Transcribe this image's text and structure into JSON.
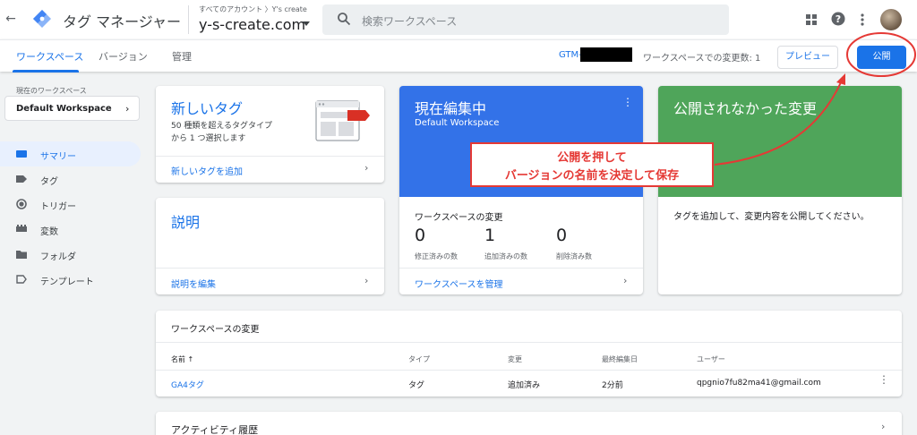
{
  "header": {
    "app_name": "タグ マネージャー",
    "account_crumb": "すべてのアカウント 〉Y's create",
    "container_name": "y-s-create.com",
    "search_placeholder": "検索ワークスペース"
  },
  "subnav": {
    "tabs": [
      {
        "label": "ワークスペース"
      },
      {
        "label": "バージョン"
      },
      {
        "label": "管理"
      }
    ],
    "gtm_id": "GTM-",
    "changes_count": "ワークスペースでの変更数: 1",
    "preview_label": "プレビュー",
    "publish_label": "公開"
  },
  "sidebar": {
    "current_ws_label": "現在のワークスペース",
    "workspace_name": "Default Workspace",
    "items": [
      {
        "label": "サマリー",
        "icon": "summary-icon"
      },
      {
        "label": "タグ",
        "icon": "tag-icon"
      },
      {
        "label": "トリガー",
        "icon": "trigger-icon"
      },
      {
        "label": "変数",
        "icon": "variable-icon"
      },
      {
        "label": "フォルダ",
        "icon": "folder-icon"
      },
      {
        "label": "テンプレート",
        "icon": "template-icon"
      }
    ]
  },
  "cards": {
    "new_tag": {
      "title": "新しいタグ",
      "desc_line1": "50 種類を超えるタグタイプ",
      "desc_line2": "から 1 つ選択します",
      "link": "新しいタグを追加"
    },
    "description": {
      "title": "説明",
      "link": "説明を編集"
    },
    "current": {
      "title": "現在編集中",
      "workspace": "Default Workspace",
      "changes_title": "ワークスペースの変更",
      "stats": [
        {
          "value": "0",
          "label": "修正済みの数"
        },
        {
          "value": "1",
          "label": "追加済みの数"
        },
        {
          "value": "0",
          "label": "削除済み数"
        }
      ],
      "link": "ワークスペースを管理"
    },
    "unpublished": {
      "title": "公開されなかった変更",
      "text": "タグを追加して、変更内容を公開してください。"
    }
  },
  "changes_table": {
    "title": "ワークスペースの変更",
    "columns": [
      "名前 ↑",
      "タイプ",
      "変更",
      "最終編集日",
      "ユーザー"
    ],
    "rows": [
      {
        "name": "GA4タグ",
        "type": "タグ",
        "change": "追加済み",
        "edited": "2分前",
        "user": "qpgnio7fu82ma41@gmail.com"
      }
    ]
  },
  "activity": {
    "title": "アクティビティ履歴"
  },
  "annotation": {
    "line1": "公開を押して",
    "line2": "バージョンの名前を決定して保存"
  },
  "colors": {
    "accent_blue": "#1a73e8",
    "current_card_blue": "#3372e8",
    "unpublished_green": "#4fa55a",
    "annotation_red": "#e53935"
  }
}
